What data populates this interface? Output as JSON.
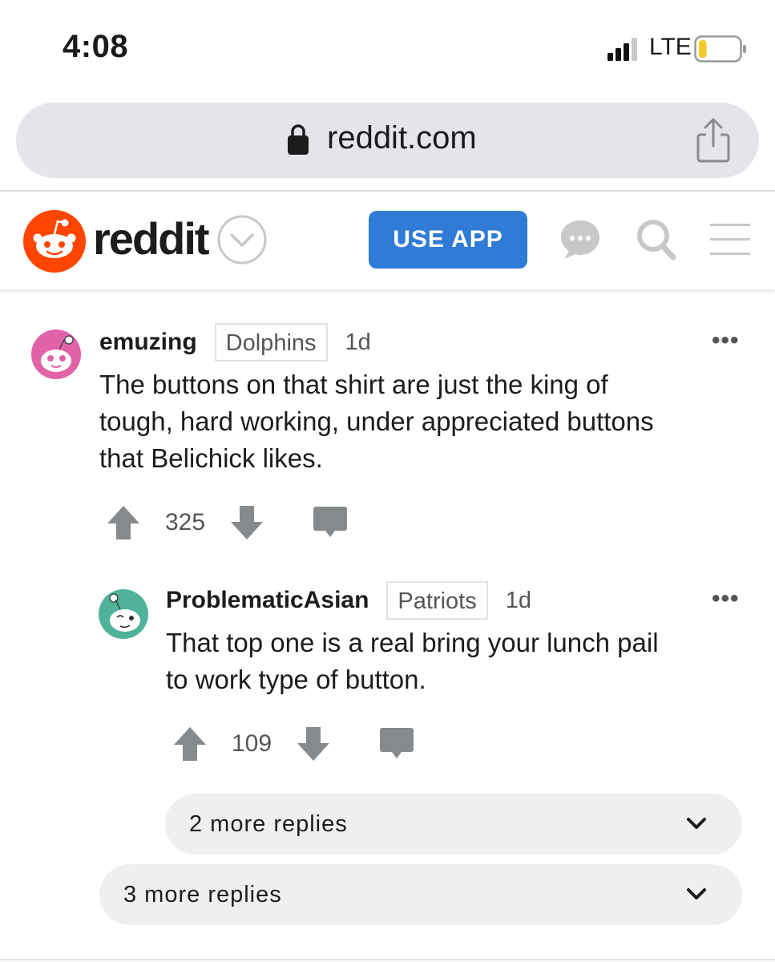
{
  "status_bar": {
    "time": "4:08",
    "network": "LTE",
    "battery_level": 0.2
  },
  "browser": {
    "url": "reddit.com",
    "lock_icon": "lock-icon",
    "share_icon": "share-icon"
  },
  "header": {
    "wordmark": "reddit",
    "use_app_label": "USE APP",
    "icons": [
      "snoo-logo",
      "chevron-down-icon",
      "chat-icon",
      "search-icon",
      "menu-icon"
    ],
    "colors": {
      "brand": "#ff4500",
      "button": "#2f7bd7"
    }
  },
  "comments": [
    {
      "username": "emuzing",
      "flair": "Dolphins",
      "age": "1d",
      "body": "The buttons on that shirt are just the king of\ntough, hard working, under appreciated buttons\nthat Belichick likes.",
      "votes": "325",
      "more": "•••"
    },
    {
      "username": "ProblematicAsian",
      "flair": "Patriots",
      "age": "1d",
      "body": "That top one is a real bring your lunch pail\nto work type of button.",
      "votes": "109",
      "more": "•••"
    }
  ],
  "more_replies": [
    {
      "label": "2 more replies"
    },
    {
      "label": "3 more replies"
    }
  ]
}
